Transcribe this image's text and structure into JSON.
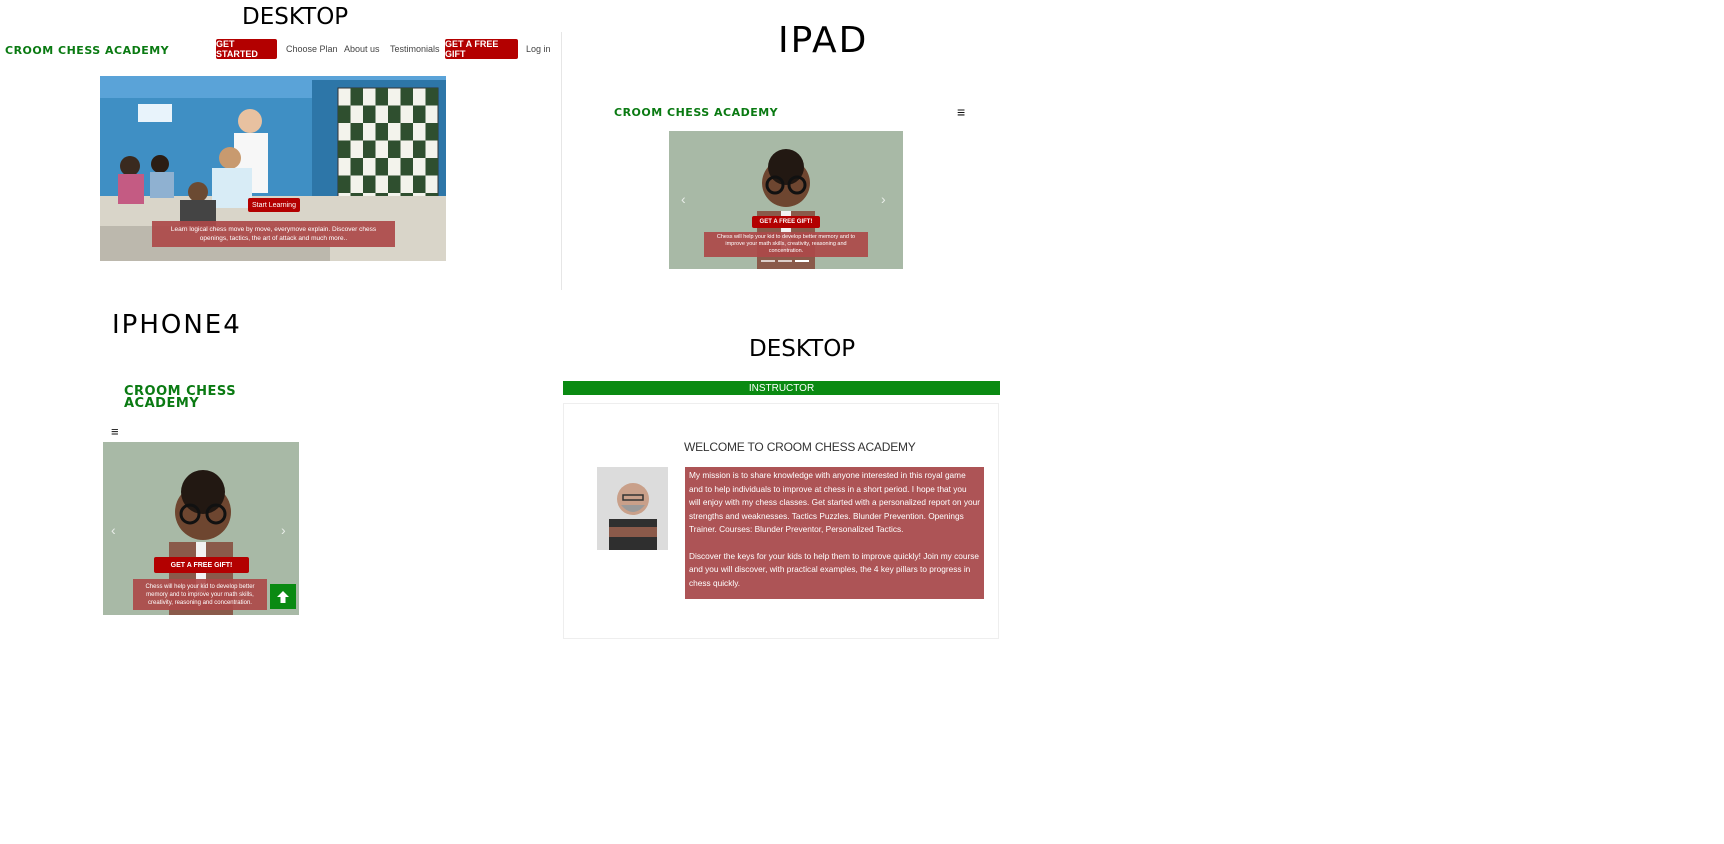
{
  "desktop_top": {
    "label": "DESKTOP",
    "logo": "CROOM CHESS ACADEMY",
    "nav": {
      "get_started": "GET STARTED",
      "choose_plan": "Choose Plan",
      "about": "About us",
      "testimonials": "Testimonials",
      "free_gift": "GET A FREE GIFT",
      "login": "Log in"
    },
    "hero": {
      "cta": "Start Learning",
      "caption": "Learn logical chess move by move, everymove explain. Discover chess openings, tactics, the art of attack and much more.."
    }
  },
  "ipad": {
    "label": "IPAD",
    "logo": "CROOM CHESS ACADEMY",
    "menu_icon": "≡",
    "hero": {
      "cta": "GET A FREE GIFT!",
      "caption": "Chess will help your kid to develop better memory and to improve your math skills, creativity, reasoning and concentration."
    }
  },
  "iphone": {
    "label": "IPHONE4",
    "logo": "CROOM CHESS ACADEMY",
    "menu_icon": "≡",
    "hero": {
      "cta": "GET A FREE GIFT!",
      "caption": "Chess will help your kid to develop better memory and to improve your math skills, creativity, reasoning and concentration."
    }
  },
  "desktop_bottom": {
    "label": "DESKTOP",
    "bar_title": "INSTRUCTOR",
    "heading": "WELCOME TO CROOM CHESS ACADEMY",
    "para1": "My mission is to share knowledge with anyone interested in this royal game and to help individuals to improve at chess in a short period. I hope that you will enjoy with my chess classes. Get started with a personalized report on your strengths and weaknesses. Tactics Puzzles. Blunder Prevention. Openings Trainer. Courses: Blunder Preventor, Personalized Tactics.",
    "para2": "Discover the keys for your kids to help them to improve quickly! Join my course and you will discover, with practical examples, the 4 key pillars to progress in chess quickly."
  },
  "colors": {
    "brand_green": "#0a7a12",
    "cta_red": "#b30000",
    "caption_red": "#ad4949"
  },
  "icons": {
    "back_to_top": "arrow-up-icon",
    "menu": "hamburger-icon",
    "prev": "chevron-left-icon",
    "next": "chevron-right-icon"
  }
}
